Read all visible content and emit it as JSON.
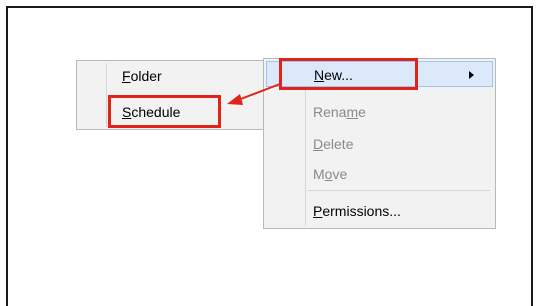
{
  "context_menu": {
    "items": [
      {
        "prefix": "",
        "accel": "N",
        "suffix": "ew...",
        "enabled": true,
        "has_submenu": true,
        "highlighted": true
      },
      {
        "prefix": "Rena",
        "accel": "m",
        "suffix": "e",
        "enabled": false
      },
      {
        "prefix": "",
        "accel": "D",
        "suffix": "elete",
        "enabled": false
      },
      {
        "prefix": "M",
        "accel": "o",
        "suffix": "ve",
        "enabled": false
      },
      {
        "prefix": "",
        "accel": "P",
        "suffix": "ermissions...",
        "enabled": true
      }
    ]
  },
  "submenu": {
    "items": [
      {
        "prefix": "",
        "accel": "F",
        "suffix": "older"
      },
      {
        "prefix": "",
        "accel": "S",
        "suffix": "chedule",
        "highlighted": true
      }
    ]
  },
  "annotation": {
    "color": "#e2231a"
  }
}
